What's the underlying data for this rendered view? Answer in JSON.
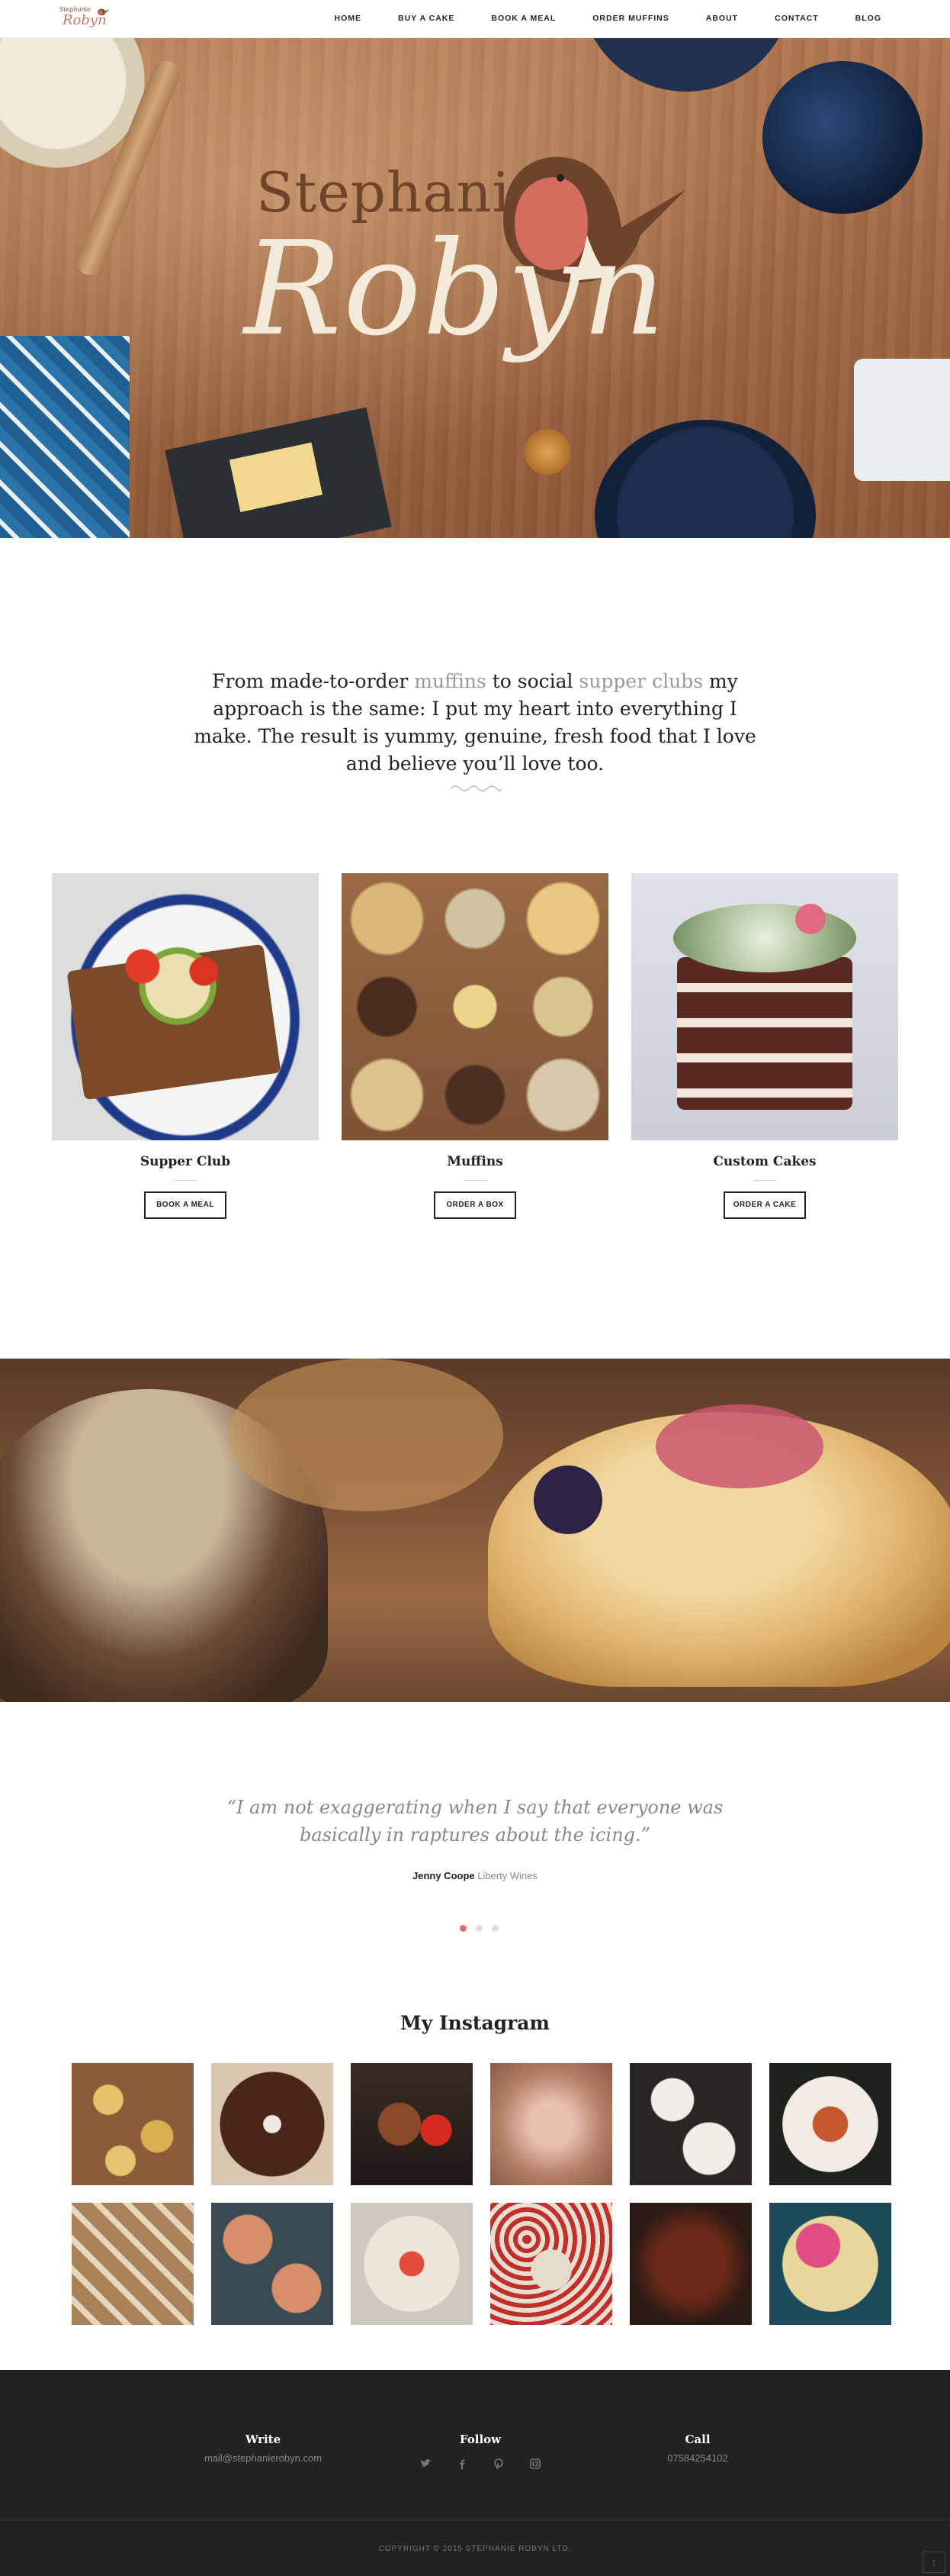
{
  "nav": {
    "logo_small": "Stephanie",
    "logo_big": "Robyn",
    "items": [
      "HOME",
      "BUY A CAKE",
      "BOOK A MEAL",
      "ORDER MUFFINS",
      "ABOUT",
      "CONTACT",
      "BLOG"
    ]
  },
  "hero": {
    "line1": "Stephanie",
    "line2": "Robyn"
  },
  "intro": {
    "p1": "From made-to-order ",
    "link1": "muffins",
    "p2": " to social ",
    "link2": "supper clubs",
    "p3": " my approach is the same: I put my heart into everything I make. The result is yummy, genuine, fresh food that I love and believe you’ll love too."
  },
  "cards": [
    {
      "title": "Supper Club",
      "button": "BOOK A MEAL"
    },
    {
      "title": "Muffins",
      "button": "ORDER A BOX"
    },
    {
      "title": "Custom Cakes",
      "button": "ORDER A CAKE"
    }
  ],
  "testimonial": {
    "quote": "“I am not exaggerating when I say that everyone was basically in raptures about the icing.”",
    "name": "Jenny Coope",
    "company": "Liberty Wines",
    "active_slide": 1,
    "slide_count": 3
  },
  "instagram": {
    "title": "My Instagram"
  },
  "footer": {
    "write_label": "Write",
    "write_value": "mail@stephanierobyn.com",
    "follow_label": "Follow",
    "call_label": "Call",
    "call_value": "07584254102",
    "social_icons": [
      "twitter-icon",
      "facebook-icon",
      "pinterest-icon",
      "instagram-icon"
    ],
    "copyright": "COPYRIGHT © 2015 STEPHANIE ROBYN LTD."
  },
  "colors": {
    "accent": "#e06c6c",
    "footer_bg": "#222222",
    "muted_link": "#999999"
  }
}
